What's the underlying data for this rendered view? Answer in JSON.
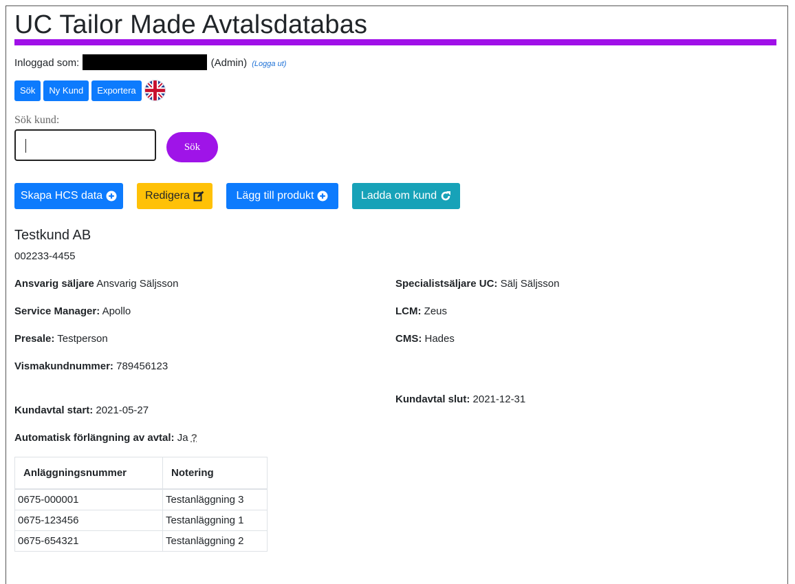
{
  "header": {
    "title": "UC Tailor Made Avtalsdatabas",
    "accent_color": "#a010e8"
  },
  "login": {
    "label": "Inloggad som:",
    "role": "(Admin)",
    "logout": "(Logga ut)"
  },
  "nav": {
    "search": "Sök",
    "new_customer": "Ny Kund",
    "export": "Exportera",
    "language_icon": "uk-flag-icon"
  },
  "search": {
    "label": "Sök kund:",
    "value": "",
    "button": "Sök"
  },
  "actions": {
    "create_hcs": "Skapa HCS data",
    "edit": "Redigera",
    "add_product": "Lägg till produkt",
    "reload": "Ladda om kund"
  },
  "customer": {
    "name": "Testkund AB",
    "org_number": "002233-4455",
    "responsible_seller_label": "Ansvarig säljare",
    "responsible_seller": "Ansvarig Säljsson",
    "specialist_seller_label": "Specialistsäljare UC:",
    "specialist_seller": "Sälj Säljsson",
    "service_manager_label": "Service Manager:",
    "service_manager": "Apollo",
    "lcm_label": "LCM:",
    "lcm": "Zeus",
    "presale_label": "Presale:",
    "presale": "Testperson",
    "cms_label": "CMS:",
    "cms": "Hades",
    "visma_label": "Vismakundnummer:",
    "visma": "789456123",
    "contract_start_label": "Kundavtal start:",
    "contract_start": "2021-05-27",
    "contract_end_label": "Kundavtal slut:",
    "contract_end": "2021-12-31",
    "auto_renew_label": "Automatisk förlängning av avtal:",
    "auto_renew": "Ja",
    "auto_renew_help": "?"
  },
  "facilities": {
    "headers": [
      "Anläggningsnummer",
      "Notering"
    ],
    "rows": [
      [
        "0675-000001",
        "Testanläggning 3"
      ],
      [
        "0675-123456",
        "Testanläggning 1"
      ],
      [
        "0675-654321",
        "Testanläggning 2"
      ]
    ]
  }
}
